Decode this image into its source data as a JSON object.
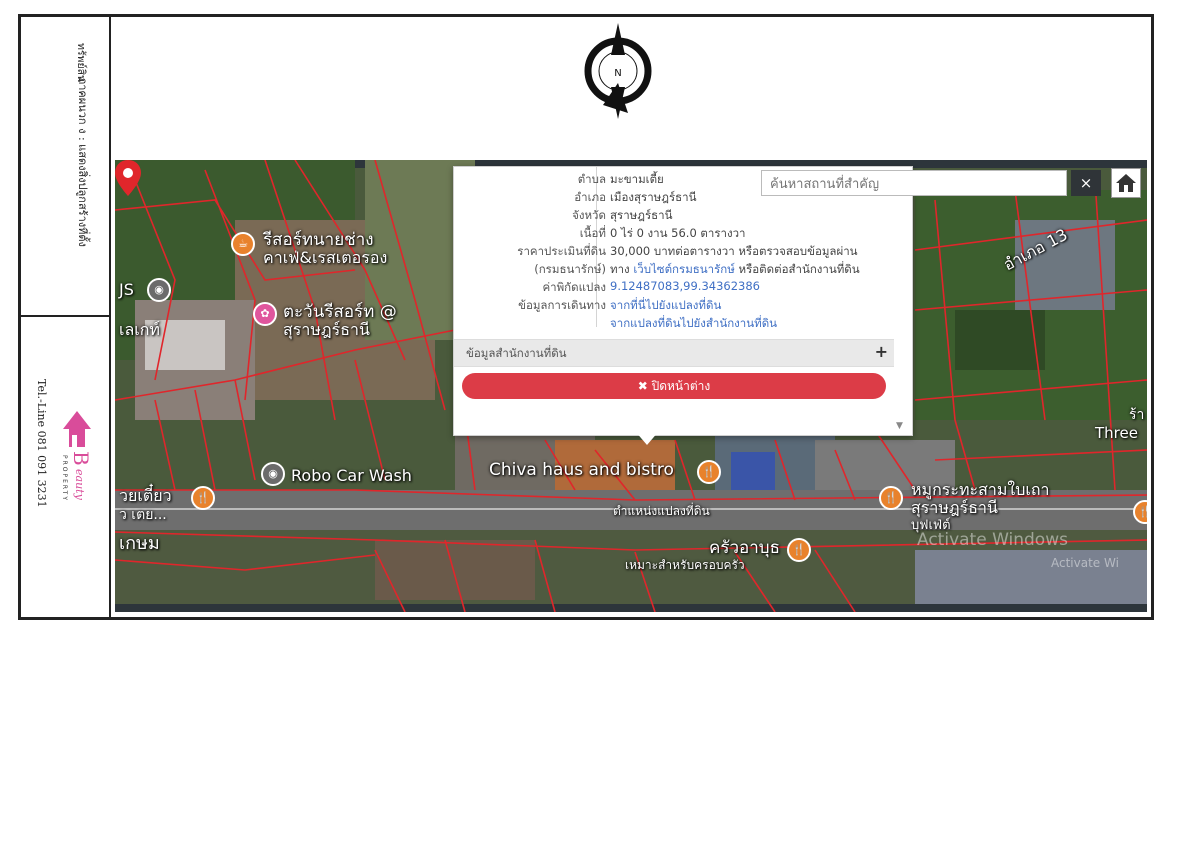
{
  "sidebar": {
    "annex_title": "ภาคผนวก ง : แสดงสิ่งปลูกสร้างที่ตั้ง",
    "annex_subtitle": "ทรัพย์สิน",
    "tel": "Tel.-Line 081 091 3231",
    "brand_initial": "B",
    "brand_name": "eauty",
    "brand_sub": "PROPERTY"
  },
  "compass": {
    "north_label": "N"
  },
  "popup": {
    "rows": [
      {
        "label": "ตำบล",
        "value": "มะขามเตี้ย"
      },
      {
        "label": "อำเภอ",
        "value": "เมืองสุราษฎร์ธานี"
      },
      {
        "label": "จังหวัด",
        "value": "สุราษฎร์ธานี"
      },
      {
        "label": "เนื้อที่",
        "value": "0 ไร่ 0 งาน 56.0 ตารางวา"
      },
      {
        "label": "ราคาประเมินที่ดิน",
        "value": "30,000 บาทต่อตารางวา หรือตรวจสอบข้อมูลผ่าน"
      },
      {
        "label": "(กรมธนารักษ์)",
        "value_prefix": "ทาง",
        "value_link": "เว็บไซต์กรมธนารักษ์",
        "value_suffix": "หรือติดต่อสำนักงานที่ดิน"
      },
      {
        "label": "ค่าพิกัดแปลง",
        "value": "9.12487083,99.34362386"
      },
      {
        "label": "ข้อมูลการเดินทาง",
        "value": "จากที่นี่ไปยังแปลงที่ดิน"
      },
      {
        "label": "",
        "value": "จากแปลงที่ดินไปยังสำนักงานที่ดิน"
      }
    ],
    "office_section": "ข้อมูลสำนักงานที่ดิน",
    "expand_symbol": "+",
    "close_label": "✖ ปิดหน้าต่าง"
  },
  "search": {
    "placeholder": "ค้นหาสถานที่สำคัญ",
    "clear_label": "×"
  },
  "map_labels": {
    "resort_cafe_1": "รีสอร์ทนายช่าง",
    "resort_cafe_2": "คาเฟ่&เรสเตอรอง",
    "sun_resort_1": "ตะวันรีสอร์ท @",
    "sun_resort_2": "สุราษฎร์ธานี",
    "robo_car_wash": "Robo Car Wash",
    "chiva_haus": "Chiva haus and bistro",
    "parcel_position": "ตำแหน่งแปลงที่ดิน",
    "kitchen": "ครัวอาบุธ",
    "kitchen_sub": "เหมาะสำหรับครอบครัว",
    "mookata_1": "หมูกระทะสามใบเถา",
    "mookata_2": "สุราษฎร์ธานี",
    "mookata_3": "บุฟเฟ่ต์",
    "district_13": "อำเภอ 13",
    "three": "Three",
    "left_a": "JS",
    "left_b": "เลเกท์",
    "left_c": "วยเตี๋ยว",
    "left_d": "ว เตย...",
    "left_e": "เกษม",
    "right_fragment": "ร้า"
  },
  "watermark": {
    "line1": "Activate Windows",
    "line2": "Activate Wi"
  },
  "colors": {
    "parcel_line": "#e0262b",
    "close_button": "#dc3c47",
    "link": "#3f6fc4",
    "pin_food": "#e8822c",
    "pin_pink": "#e0569d"
  }
}
